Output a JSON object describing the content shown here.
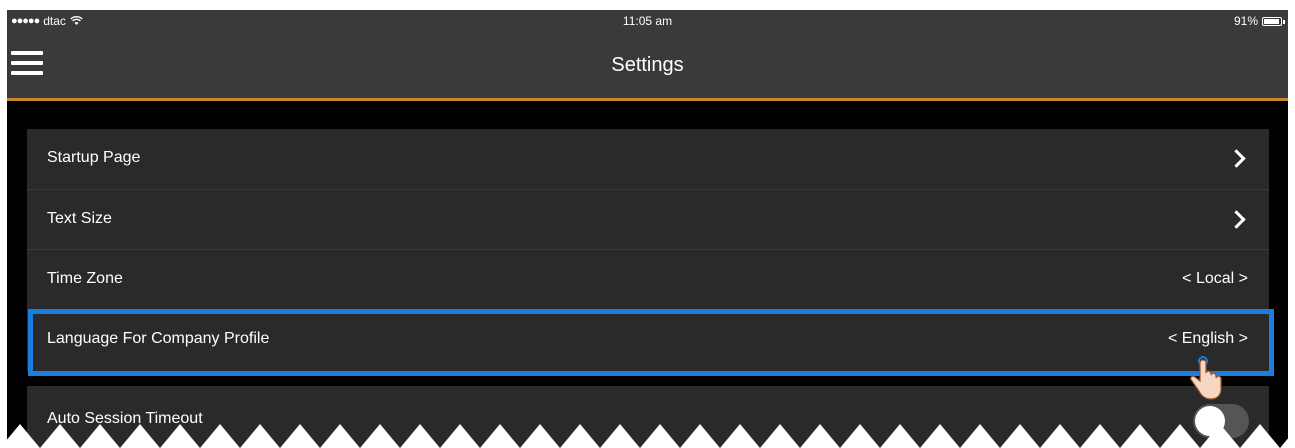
{
  "status_bar": {
    "carrier": "dtac",
    "time": "11:05 am",
    "battery_percent": "91%",
    "battery_level": 0.91,
    "signal_icon": "signal-dots-icon",
    "wifi_icon": "wifi-icon"
  },
  "nav": {
    "title": "Settings",
    "menu_icon": "hamburger-icon"
  },
  "settings": {
    "rows": [
      {
        "label": "Startup Page",
        "accessory": "chevron"
      },
      {
        "label": "Text Size",
        "accessory": "chevron"
      },
      {
        "label": "Time Zone",
        "value": "< Local >"
      },
      {
        "label": "Language For Company Profile",
        "value": "< English >"
      }
    ],
    "auto_session": {
      "label": "Auto Session Timeout",
      "toggle_on": false
    }
  },
  "colors": {
    "accent_orange": "#c8852c",
    "highlight_blue": "#1a7de0",
    "nav_bg": "#3a3a3a",
    "row_bg": "#2a2a2a"
  }
}
